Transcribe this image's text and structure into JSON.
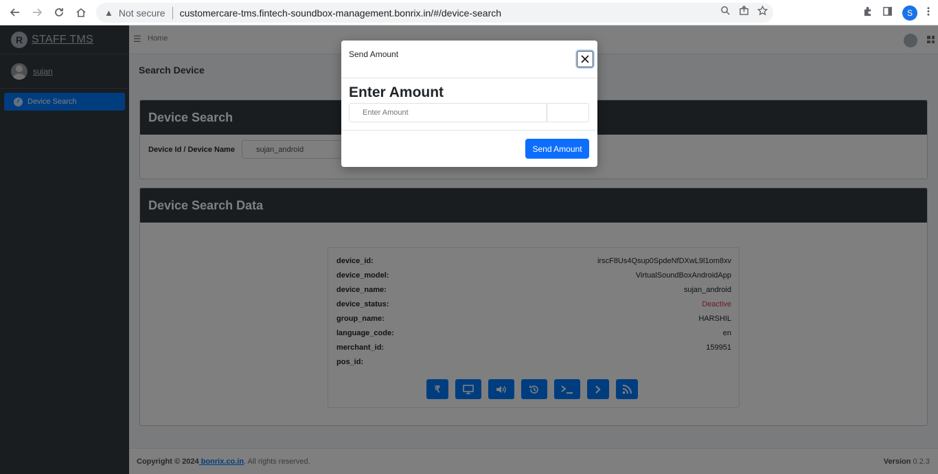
{
  "browser": {
    "security_label": "Not secure",
    "url": "customercare-tms.fintech-soundbox-management.bonrix.in/#/device-search",
    "profile_initial": "S"
  },
  "sidebar": {
    "brand": "STAFF TMS",
    "brand_initial": "R",
    "user": "sujan",
    "items": [
      {
        "label": "Device Search"
      }
    ]
  },
  "topnav": {
    "breadcrumb": "Home"
  },
  "page": {
    "title": "Search Device"
  },
  "search_card": {
    "title": "Device Search",
    "field_label": "Device Id / Device Name",
    "field_value": "sujan_android"
  },
  "data_card": {
    "title": "Device Search Data",
    "rows": [
      {
        "key": "device_id:",
        "value": "irscF8Us4Qsup0SpdeNfDXwL9l1om8xv"
      },
      {
        "key": "device_model:",
        "value": "VirtualSoundBoxAndroidApp"
      },
      {
        "key": "device_name:",
        "value": "sujan_android"
      },
      {
        "key": "device_status:",
        "value": "Deactive"
      },
      {
        "key": "group_name:",
        "value": "HARSHIL"
      },
      {
        "key": "language_code:",
        "value": "en"
      },
      {
        "key": "merchant_id:",
        "value": "159951"
      },
      {
        "key": "pos_id:",
        "value": ""
      }
    ],
    "actions": [
      {
        "name": "rupee-icon",
        "glyph": "₹"
      },
      {
        "name": "monitor-icon",
        "glyph": ""
      },
      {
        "name": "volume-icon",
        "glyph": ""
      },
      {
        "name": "history-icon",
        "glyph": ""
      },
      {
        "name": "terminal-icon",
        "glyph": ""
      },
      {
        "name": "chevron-right-icon",
        "glyph": ""
      },
      {
        "name": "rss-icon",
        "glyph": ""
      }
    ]
  },
  "footer": {
    "copyright_prefix": "Copyright © 2024",
    "link": " bonrix.co.in",
    "suffix": ". All rights reserved.",
    "version_label": "Version",
    "version": " 0.2.3"
  },
  "modal": {
    "title": "Send Amount",
    "heading": "Enter Amount",
    "input_placeholder": "Enter Amount",
    "input_value": "",
    "submit_label": "Send Amount"
  },
  "colors": {
    "sidebar_bg": "#343a40",
    "primary": "#007bff",
    "danger": "#dc3545",
    "card_header": "#343a40"
  }
}
